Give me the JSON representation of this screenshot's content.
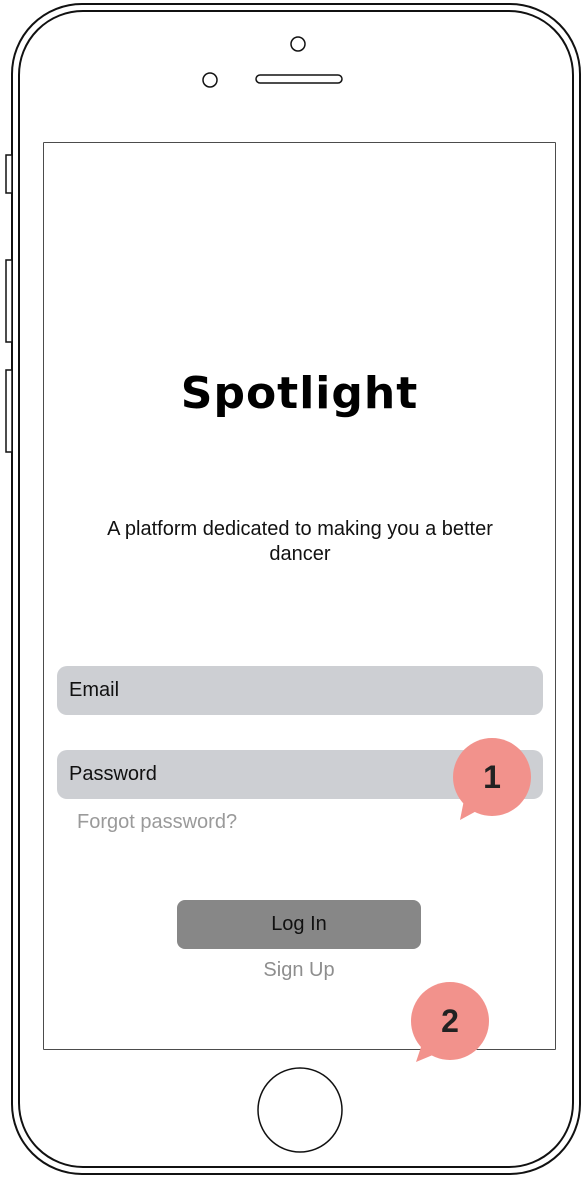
{
  "app": {
    "title": "Spotlight",
    "tagline": "A platform dedicated to making you a better dancer"
  },
  "form": {
    "email_placeholder": "Email",
    "password_placeholder": "Password",
    "forgot_label": "Forgot password?",
    "login_label": "Log In",
    "signup_label": "Sign Up"
  },
  "annotations": [
    {
      "number": "1"
    },
    {
      "number": "2"
    }
  ],
  "colors": {
    "field_bg": "#cdcfd3",
    "button_bg": "#878787",
    "callout": "#f2928c",
    "muted_text": "#9a9a9a"
  }
}
